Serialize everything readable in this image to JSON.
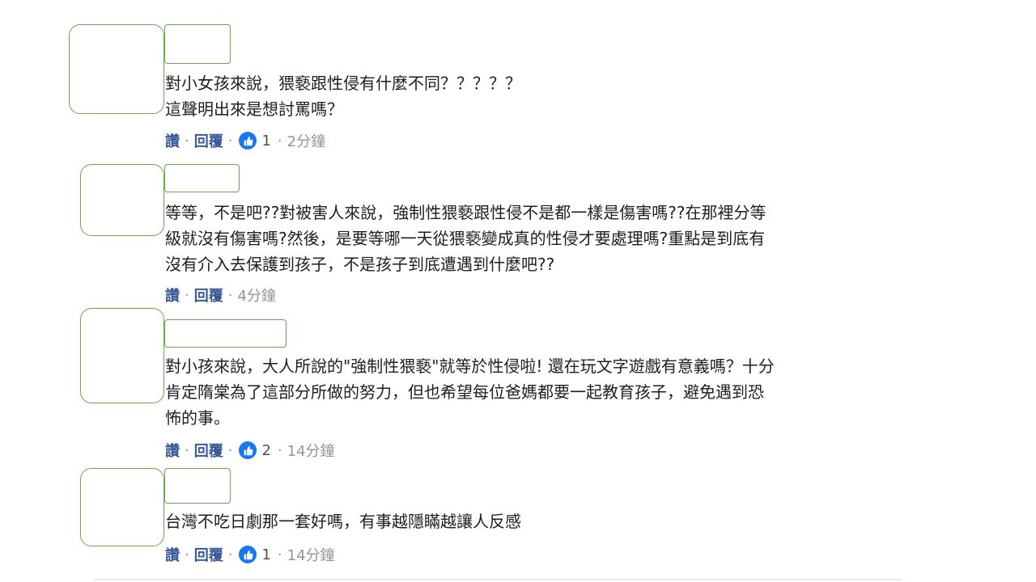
{
  "comments": [
    {
      "lines": [
        "對小女孩來說，猥褻跟性侵有什麼不同？？？？？",
        "這聲明出來是想討罵嗎？"
      ],
      "actions": {
        "like": "讚",
        "reply": "回覆",
        "sep": "·",
        "reaction_count": "1",
        "time": "2分鐘"
      }
    },
    {
      "lines": [
        "等等，不是吧??對被害人來說，強制性猥褻跟性侵不是都一樣是傷害嗎??在那裡分等",
        "級就沒有傷害嗎?然後，是要等哪一天從猥褻變成真的性侵才要處理嗎?重點是到底有",
        "沒有介入去保護到孩子，不是孩子到底遭遇到什麼吧??"
      ],
      "actions": {
        "like": "讚",
        "reply": "回覆",
        "sep": "·",
        "time": "4分鐘"
      }
    },
    {
      "lines": [
        "對小孩來說，大人所說的\"強制性猥褻\"就等於性侵啦! 還在玩文字遊戲有意義嗎？十分",
        "肯定隋棠為了這部分所做的努力，但也希望每位爸媽都要一起教育孩子，避免遇到恐",
        "怖的事。"
      ],
      "actions": {
        "like": "讚",
        "reply": "回覆",
        "sep": "·",
        "reaction_count": "2",
        "time": "14分鐘"
      }
    },
    {
      "lines": [
        "台灣不吃日劇那一套好嗎，有事越隱瞞越讓人反感"
      ],
      "actions": {
        "like": "讚",
        "reply": "回覆",
        "sep": "·",
        "reaction_count": "1",
        "time": "14分鐘"
      }
    }
  ],
  "colors": {
    "link": "#385898",
    "meta": "#90949c",
    "like_badge": "#1877f2",
    "redaction_border": "#6aa84f"
  },
  "icons": {
    "reaction": "like-thumbs-up-icon"
  }
}
